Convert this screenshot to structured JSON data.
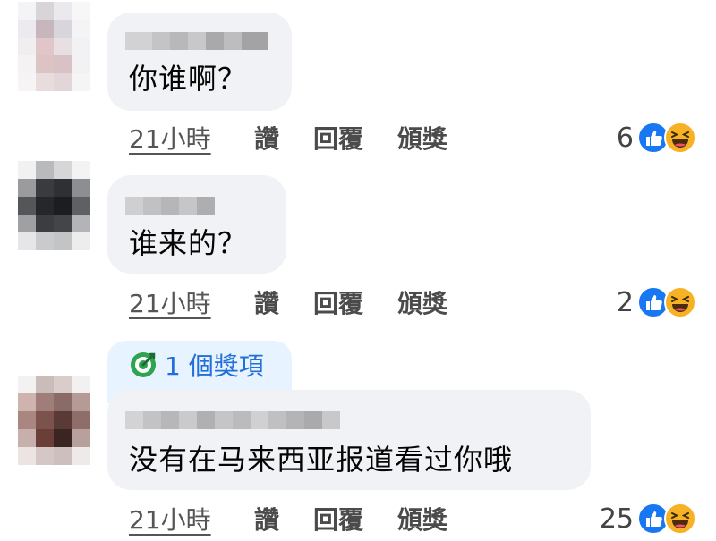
{
  "comments": [
    {
      "text": "你谁啊？",
      "time": "21小時",
      "like_label": "讚",
      "reply_label": "回覆",
      "award_label": "頒獎",
      "reaction_count": "6",
      "reaction_icons": [
        "like-icon",
        "haha-icon"
      ]
    },
    {
      "text": "谁来的？",
      "time": "21小時",
      "like_label": "讚",
      "reply_label": "回覆",
      "award_label": "頒獎",
      "reaction_count": "2",
      "reaction_icons": [
        "like-icon",
        "haha-icon"
      ]
    },
    {
      "award_badge": "1 個獎項",
      "text": "没有在马来西亚报道看过你哦",
      "time": "21小時",
      "like_label": "讚",
      "reply_label": "回覆",
      "award_label": "頒獎",
      "reaction_count": "25",
      "reaction_icons": [
        "like-icon",
        "haha-icon"
      ]
    }
  ],
  "colors": {
    "bubble": "#f0f2f5",
    "award_chip": "#e7f3ff",
    "award_text": "#216fdb",
    "like_blue": "#1877f2",
    "haha_yellow": "#f7b125"
  }
}
